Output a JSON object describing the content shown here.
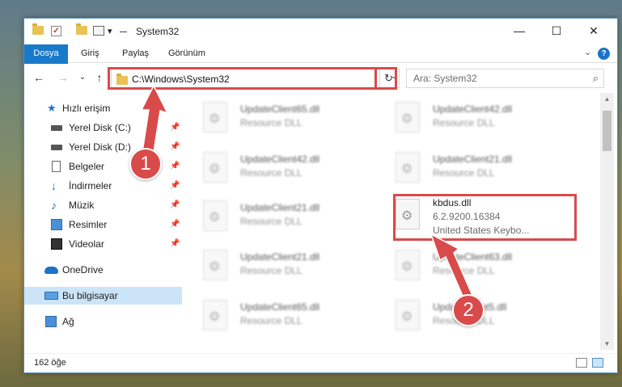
{
  "window": {
    "title": "System32",
    "minimize_icon": "—",
    "maximize_icon": "☐",
    "close_icon": "✕"
  },
  "quick_access_toolbar": {
    "dropdown_icon": "▾",
    "check_glyph": "✓"
  },
  "ribbon": {
    "tabs": [
      {
        "label": "Dosya",
        "active": true
      },
      {
        "label": "Giriş"
      },
      {
        "label": "Paylaş"
      },
      {
        "label": "Görünüm"
      }
    ],
    "collapse_icon": "⌄",
    "help_icon": "?"
  },
  "navigation": {
    "back_icon": "←",
    "forward_icon": "→",
    "recent_icon": "⌄",
    "up_icon": "↑",
    "address": "C:\\Windows\\System32",
    "address_dropdown_icon": "⌄",
    "refresh_icon": "↻",
    "search_placeholder": "Ara: System32",
    "search_icon": "⌕"
  },
  "sidebar": {
    "items": [
      {
        "label": "Hızlı erişim",
        "icon": "star-icon",
        "glyph": "★"
      },
      {
        "label": "Yerel Disk (C:)",
        "icon": "drive-icon",
        "pinned": true
      },
      {
        "label": "Yerel Disk (D:)",
        "icon": "drive-icon",
        "pinned": true
      },
      {
        "label": "Belgeler",
        "icon": "document-icon",
        "pinned": true
      },
      {
        "label": "İndirmeler",
        "icon": "download-icon",
        "glyph": "↓",
        "pinned": true
      },
      {
        "label": "Müzik",
        "icon": "music-icon",
        "glyph": "♪",
        "pinned": true
      },
      {
        "label": "Resimler",
        "icon": "pictures-icon",
        "pinned": true
      },
      {
        "label": "Videolar",
        "icon": "video-icon",
        "pinned": true
      },
      {
        "label": "OneDrive",
        "icon": "cloud-icon"
      },
      {
        "label": "Bu bilgisayar",
        "icon": "computer-icon",
        "selected": true
      },
      {
        "label": "Ağ",
        "icon": "network-icon"
      }
    ],
    "pin_glyph": "📌"
  },
  "files": [
    {
      "name": "UpdateClient65.dll",
      "type": "Resource DLL"
    },
    {
      "name": "UpdateClient42.dll",
      "type": "Resource DLL"
    },
    {
      "name": "UpdateClient42.dll",
      "type": "Resource DLL"
    },
    {
      "name": "UpdateClient21.dll",
      "type": "Resource DLL"
    },
    {
      "name": "UpdateClient21.dll",
      "type": "Resource DLL"
    },
    {
      "name": "kbdus.dll",
      "version": "6.2.9200.16384",
      "description": "United States Keybo..."
    },
    {
      "name": "UpdateClient21.dll",
      "type": "Resource DLL"
    },
    {
      "name": "UpdateClient63.dll",
      "type": "Resource DLL"
    },
    {
      "name": "UpdateClient65.dll",
      "type": "Resource DLL"
    },
    {
      "name": "UpdateClient5.dll",
      "type": "Resource DLL"
    }
  ],
  "status_bar": {
    "item_count": "162 öğe"
  },
  "callouts": {
    "one": "1",
    "two": "2"
  },
  "colors": {
    "accent": "#1979ca",
    "highlight": "#d94a4a",
    "selected": "#cce4f7"
  }
}
